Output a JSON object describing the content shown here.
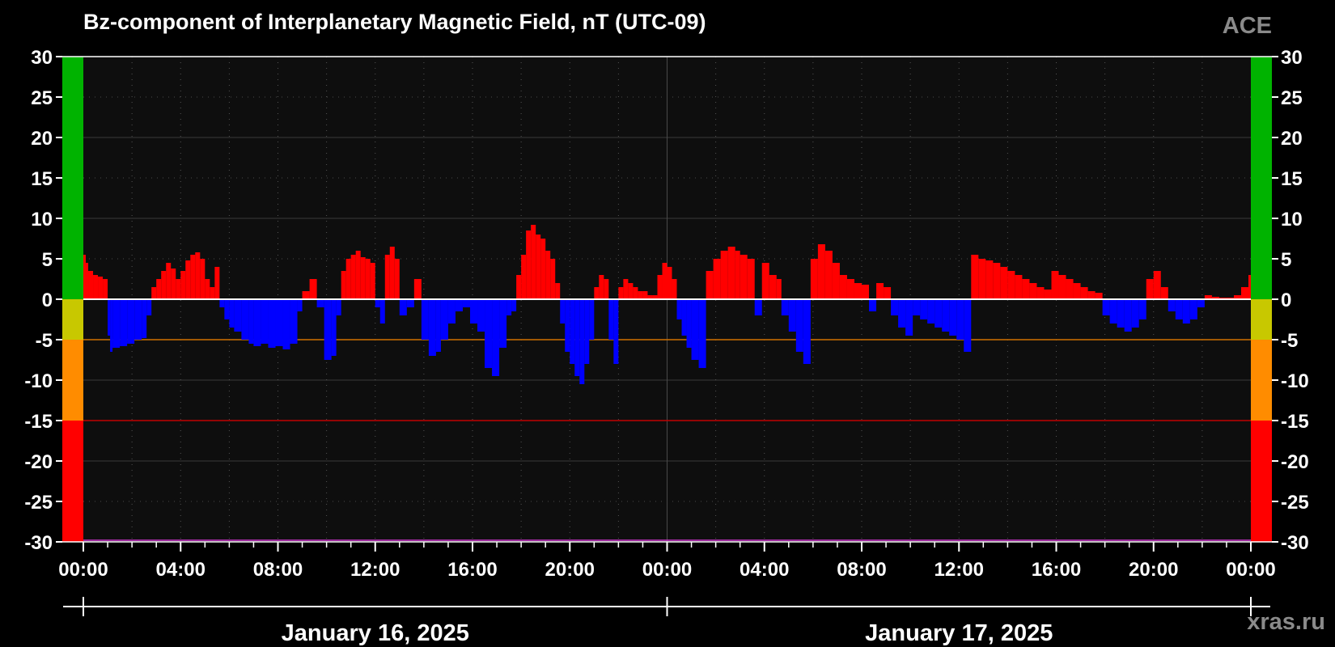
{
  "header": {
    "title": "Bz-component of Interplanetary Magnetic Field, nT (UTC-09)",
    "source": "ACE"
  },
  "footer": {
    "watermark": "xras.ru"
  },
  "colors": {
    "positive": "#ff0000",
    "negative": "#0000ff",
    "plot_bg": "#0e0e0e",
    "page_bg": "#000000",
    "zone_green": "#00b300",
    "zone_yellow": "#c8c800",
    "zone_orange": "#ff8c00",
    "zone_red": "#ff0000",
    "threshold_orange": "#d07000",
    "threshold_red": "#c00000"
  },
  "chart_data": {
    "type": "bar",
    "title": "Bz-component of Interplanetary Magnetic Field, nT (UTC-09)",
    "xlabel": "",
    "ylabel": "",
    "ylim": [
      -30,
      30
    ],
    "yticks": [
      30,
      25,
      20,
      15,
      10,
      5,
      0,
      -5,
      -10,
      -15,
      -20,
      -25,
      -30
    ],
    "xlim_hours": [
      0,
      48
    ],
    "xticks": [
      "00:00",
      "04:00",
      "08:00",
      "12:00",
      "16:00",
      "20:00",
      "00:00",
      "04:00",
      "08:00",
      "12:00",
      "16:00",
      "20:00",
      "00:00"
    ],
    "dates": [
      "January 16, 2025",
      "January 17, 2025"
    ],
    "grid": true,
    "thresholds": [
      -5,
      -15
    ],
    "bands": [
      {
        "from": 0,
        "to": 30,
        "color": "green"
      },
      {
        "from": -5,
        "to": 0,
        "color": "yellow"
      },
      {
        "from": -15,
        "to": -5,
        "color": "orange"
      },
      {
        "from": -30,
        "to": -15,
        "color": "red"
      }
    ],
    "series": [
      {
        "hours": [
          0.0,
          0.1,
          0.2,
          0.4,
          0.6,
          0.8,
          1.0,
          1.1,
          1.2,
          1.5,
          1.8,
          2.1,
          2.4,
          2.6,
          2.8,
          3.0,
          3.2,
          3.4,
          3.6,
          3.8,
          4.0,
          4.2,
          4.4,
          4.6,
          4.8,
          5.0,
          5.2,
          5.4,
          5.6,
          5.8,
          6.0,
          6.2,
          6.5,
          6.8,
          7.0,
          7.3,
          7.6,
          7.9,
          8.2,
          8.5,
          8.8,
          9.0,
          9.3,
          9.6,
          9.9,
          10.2,
          10.4,
          10.6,
          10.8,
          11.0,
          11.2,
          11.4,
          11.6,
          11.8,
          12.0,
          12.2,
          12.4,
          12.6,
          12.8,
          13.0,
          13.3,
          13.6,
          13.9,
          14.2,
          14.5,
          14.7,
          15.0,
          15.3,
          15.6,
          15.9,
          16.2,
          16.5,
          16.8,
          17.1,
          17.4,
          17.6,
          17.8,
          18.0,
          18.2,
          18.4,
          18.6,
          18.8,
          19.0,
          19.2,
          19.4,
          19.6,
          19.8,
          20.0,
          20.2,
          20.4,
          20.6,
          20.8,
          21.0,
          21.2,
          21.4,
          21.6,
          21.8,
          22.0,
          22.2,
          22.4,
          22.6,
          22.8,
          23.0,
          23.2,
          23.4,
          23.6,
          23.8,
          24.0,
          24.2,
          24.4,
          24.6,
          24.8,
          25.0,
          25.3,
          25.6,
          25.9,
          26.2,
          26.5,
          26.8,
          27.0,
          27.3,
          27.6,
          27.9,
          28.2,
          28.5,
          28.7,
          29.0,
          29.3,
          29.6,
          29.9,
          30.2,
          30.5,
          30.8,
          31.1,
          31.4,
          31.7,
          32.0,
          32.3,
          32.6,
          32.9,
          33.2,
          33.5,
          33.8,
          34.1,
          34.4,
          34.7,
          35.0,
          35.3,
          35.6,
          35.9,
          36.2,
          36.5,
          36.8,
          37.1,
          37.4,
          37.7,
          38.0,
          38.3,
          38.6,
          38.9,
          39.2,
          39.5,
          39.8,
          40.1,
          40.4,
          40.7,
          41.0,
          41.3,
          41.6,
          41.9,
          42.2,
          42.5,
          42.8,
          43.1,
          43.4,
          43.7,
          44.0,
          44.3,
          44.6,
          44.9,
          45.2,
          45.5,
          45.8,
          46.1,
          46.4,
          46.7,
          47.0,
          47.3,
          47.6,
          47.9,
          48.0
        ],
        "values": [
          5.5,
          4.5,
          3.5,
          3.0,
          2.8,
          2.5,
          -4.5,
          -6.5,
          -6.0,
          -5.8,
          -5.5,
          -5.0,
          -4.8,
          -2.0,
          1.5,
          2.5,
          3.5,
          4.5,
          3.8,
          2.5,
          3.5,
          4.8,
          5.5,
          5.8,
          5.0,
          2.5,
          1.5,
          4.0,
          -1.0,
          -2.5,
          -3.5,
          -4.0,
          -5.0,
          -5.5,
          -5.8,
          -5.5,
          -6.0,
          -5.8,
          -6.2,
          -5.5,
          -1.5,
          1.0,
          2.5,
          -1.0,
          -7.5,
          -7.0,
          -2.0,
          3.5,
          5.0,
          5.5,
          6.0,
          5.2,
          5.0,
          4.5,
          -1.0,
          -3.0,
          5.5,
          6.5,
          5.0,
          -2.0,
          -1.0,
          2.5,
          -5.0,
          -7.0,
          -6.5,
          -5.0,
          -3.0,
          -1.5,
          -1.0,
          -3.0,
          -4.0,
          -8.5,
          -9.5,
          -6.0,
          -2.0,
          -1.5,
          3.0,
          5.5,
          8.5,
          9.2,
          8.0,
          7.5,
          6.0,
          5.0,
          2.0,
          -3.0,
          -6.5,
          -8.0,
          -9.5,
          -10.5,
          -8.0,
          -5.0,
          1.5,
          3.0,
          2.5,
          -5.0,
          -8.0,
          1.5,
          2.5,
          2.0,
          1.5,
          1.0,
          1.0,
          0.5,
          0.5,
          3.0,
          4.5,
          4.0,
          2.5,
          -2.5,
          -4.5,
          -6.0,
          -7.5,
          -8.5,
          3.5,
          5.0,
          6.0,
          6.5,
          6.0,
          5.5,
          5.0,
          -2.0,
          4.5,
          3.0,
          2.5,
          -2.0,
          -4.0,
          -6.5,
          -8.0,
          5.0,
          6.8,
          6.0,
          4.5,
          3.0,
          2.5,
          2.0,
          1.8,
          -1.5,
          2.0,
          1.5,
          -2.0,
          -3.5,
          -4.5,
          -2.0,
          -2.5,
          -3.0,
          -3.5,
          -4.0,
          -4.5,
          -5.0,
          -6.5,
          5.5,
          5.0,
          4.8,
          4.5,
          4.0,
          3.5,
          3.0,
          2.5,
          2.0,
          1.5,
          1.2,
          3.5,
          3.0,
          2.5,
          2.0,
          1.5,
          1.0,
          0.8,
          -2.0,
          -3.0,
          -3.5,
          -4.0,
          -3.5,
          -2.5,
          2.5,
          3.5,
          1.5,
          -1.5,
          -2.5,
          -3.0,
          -2.5,
          -1.0,
          0.5,
          0.3,
          0.2,
          0.2,
          0.5,
          1.5,
          3.0
        ]
      }
    ]
  }
}
